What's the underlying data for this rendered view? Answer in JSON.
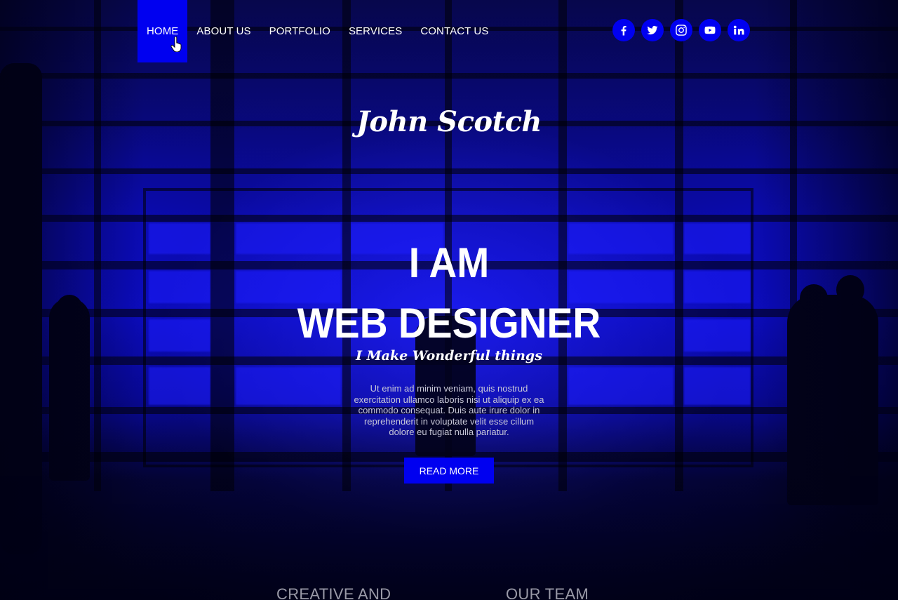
{
  "nav": {
    "items": [
      {
        "label": "HOME",
        "active": true
      },
      {
        "label": "ABOUT US",
        "active": false
      },
      {
        "label": "PORTFOLIO",
        "active": false
      },
      {
        "label": "SERVICES",
        "active": false
      },
      {
        "label": "CONTACT US",
        "active": false
      }
    ]
  },
  "social": {
    "icons": [
      "facebook-icon",
      "twitter-icon",
      "instagram-icon",
      "youtube-icon",
      "linkedin-icon"
    ]
  },
  "hero": {
    "brand": "John Scotch",
    "title_line1": "I AM",
    "title_line2": "WEB DESIGNER",
    "subtitle": "I Make Wonderful things",
    "body": "Ut enim ad minim veniam, quis nostrud exercitation ullamco laboris nisi ut aliquip ex ea commodo consequat. Duis aute irure dolor in reprehenderit in voluptate velit esse cillum dolore eu fugiat nulla pariatur.",
    "cta_label": "READ MORE"
  },
  "sections": {
    "left_heading": "CREATIVE AND",
    "right_heading": "OUR TEAM"
  },
  "colors": {
    "accent": "#0000f0",
    "text": "#ffffff",
    "muted": "#c8c8d8",
    "section_heading": "#9a9aa8"
  }
}
